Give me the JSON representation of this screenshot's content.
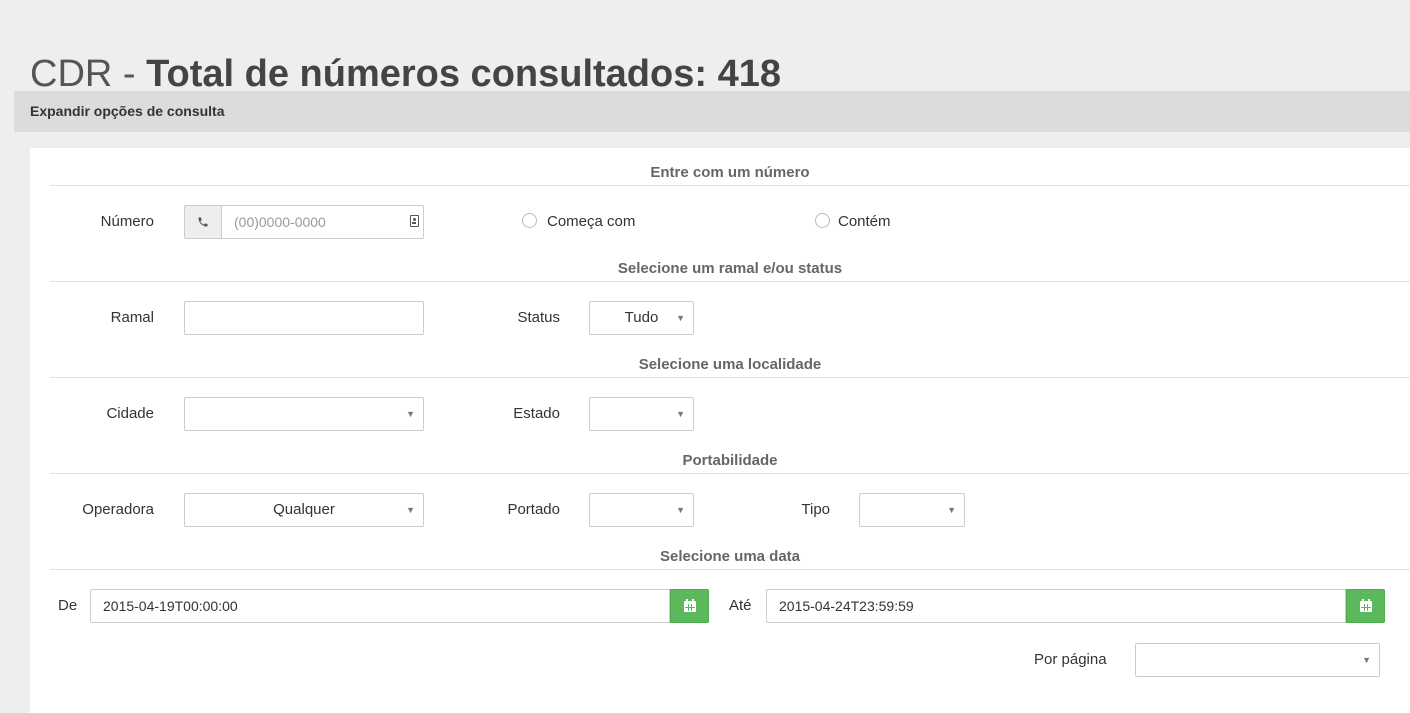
{
  "page": {
    "title_prefix": "CDR - ",
    "title_main": "Total de números consultados: 418"
  },
  "expand_bar": {
    "label": "Expandir opções de consulta"
  },
  "sections": {
    "number": "Entre com um número",
    "extension_status": "Selecione um ramal e/ou status",
    "locality": "Selecione uma localidade",
    "portability": "Portabilidade",
    "date": "Selecione uma data"
  },
  "number": {
    "label": "Número",
    "placeholder": "(00)0000-0000",
    "icon": "phone-icon",
    "trailing_icon": "contact-card-icon",
    "radio_starts_with": "Começa com",
    "radio_contains": "Contém"
  },
  "extension": {
    "label": "Ramal",
    "value": ""
  },
  "status": {
    "label": "Status",
    "selected": "Tudo"
  },
  "city": {
    "label": "Cidade",
    "selected": ""
  },
  "state": {
    "label": "Estado",
    "selected": ""
  },
  "carrier": {
    "label": "Operadora",
    "selected": "Qualquer"
  },
  "ported": {
    "label": "Portado",
    "selected": ""
  },
  "type": {
    "label": "Tipo",
    "selected": ""
  },
  "date_from": {
    "label": "De",
    "value": "2015-04-19T00:00:00"
  },
  "date_to": {
    "label": "Até",
    "value": "2015-04-24T23:59:59"
  },
  "per_page": {
    "label": "Por página",
    "selected": ""
  },
  "colors": {
    "background": "#eeeeee",
    "expand_bar": "#dcdcdc",
    "calendar_button": "#5cb85c"
  }
}
